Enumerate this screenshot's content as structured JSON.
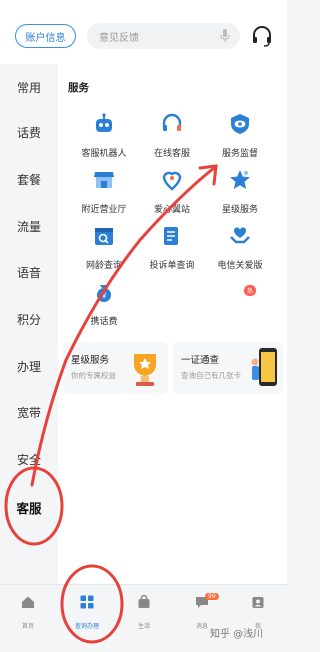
{
  "header": {
    "account_label": "账户信息",
    "search_placeholder": "意见反馈"
  },
  "categories": [
    "常用",
    "话费",
    "套餐",
    "流量",
    "语音",
    "积分",
    "办理",
    "宽带",
    "安全",
    "客服"
  ],
  "section_title": "服务",
  "services": [
    "客服机器人",
    "在线客服",
    "服务监督",
    "附近营业厅",
    "爱心翼站",
    "星级服务",
    "网龄查询",
    "投诉单查询",
    "电信关爱版",
    "携话费"
  ],
  "hot_badge": "热",
  "cards": [
    {
      "title": "星级服务",
      "subtitle": "你的专属权益"
    },
    {
      "title": "一证通查",
      "subtitle": "查询自己有几张卡"
    }
  ],
  "tabs": [
    "首页",
    "查询办理",
    "生活",
    "消息",
    "我"
  ],
  "message_badge": "99",
  "watermark": "知乎 @浅川",
  "colors": {
    "accent": "#2b7fd6",
    "annotation": "#e8403a"
  }
}
